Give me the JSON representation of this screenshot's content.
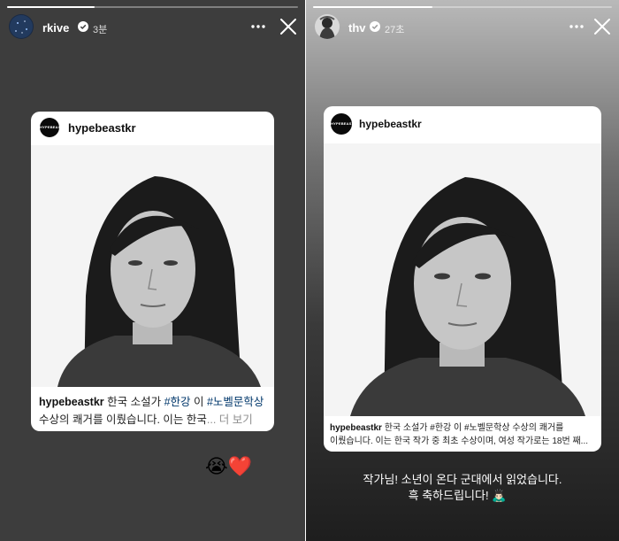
{
  "left_story": {
    "username": "rkive",
    "time": "3분",
    "progress": 0.3,
    "card": {
      "username": "hypebeastkr",
      "logo_text": "HYPEBEAST",
      "caption_user": "hypebeastkr",
      "caption_part1": " 한국 소설가 ",
      "tag1": "#한강",
      "caption_part2": " 이 ",
      "tag2": "#노벨문학상",
      "caption_line2": "수상의 쾌거를 이뤘습니다. 이는 한국",
      "more": "... 더 보기"
    },
    "reactions": "😭❤️"
  },
  "right_story": {
    "username": "thv",
    "time": "27초",
    "progress": 0.4,
    "card": {
      "username": "hypebeastkr",
      "logo_text": "HYPEBEAST",
      "caption_user": "hypebeastkr",
      "caption_line1": " 한국 소설가 #한강 이 #노벨문학상 수상의 쾌거를",
      "caption_line2": "이뤘습니다. 이는 한국 작가 중 최초 수상이며, 여성 작가로는 18번 째..."
    },
    "reply_line1": "작가님! 소년이 온다 군대에서 읽었습니다.",
    "reply_line2": "흑 축하드립니다! 🙇🏻‍♂️"
  }
}
